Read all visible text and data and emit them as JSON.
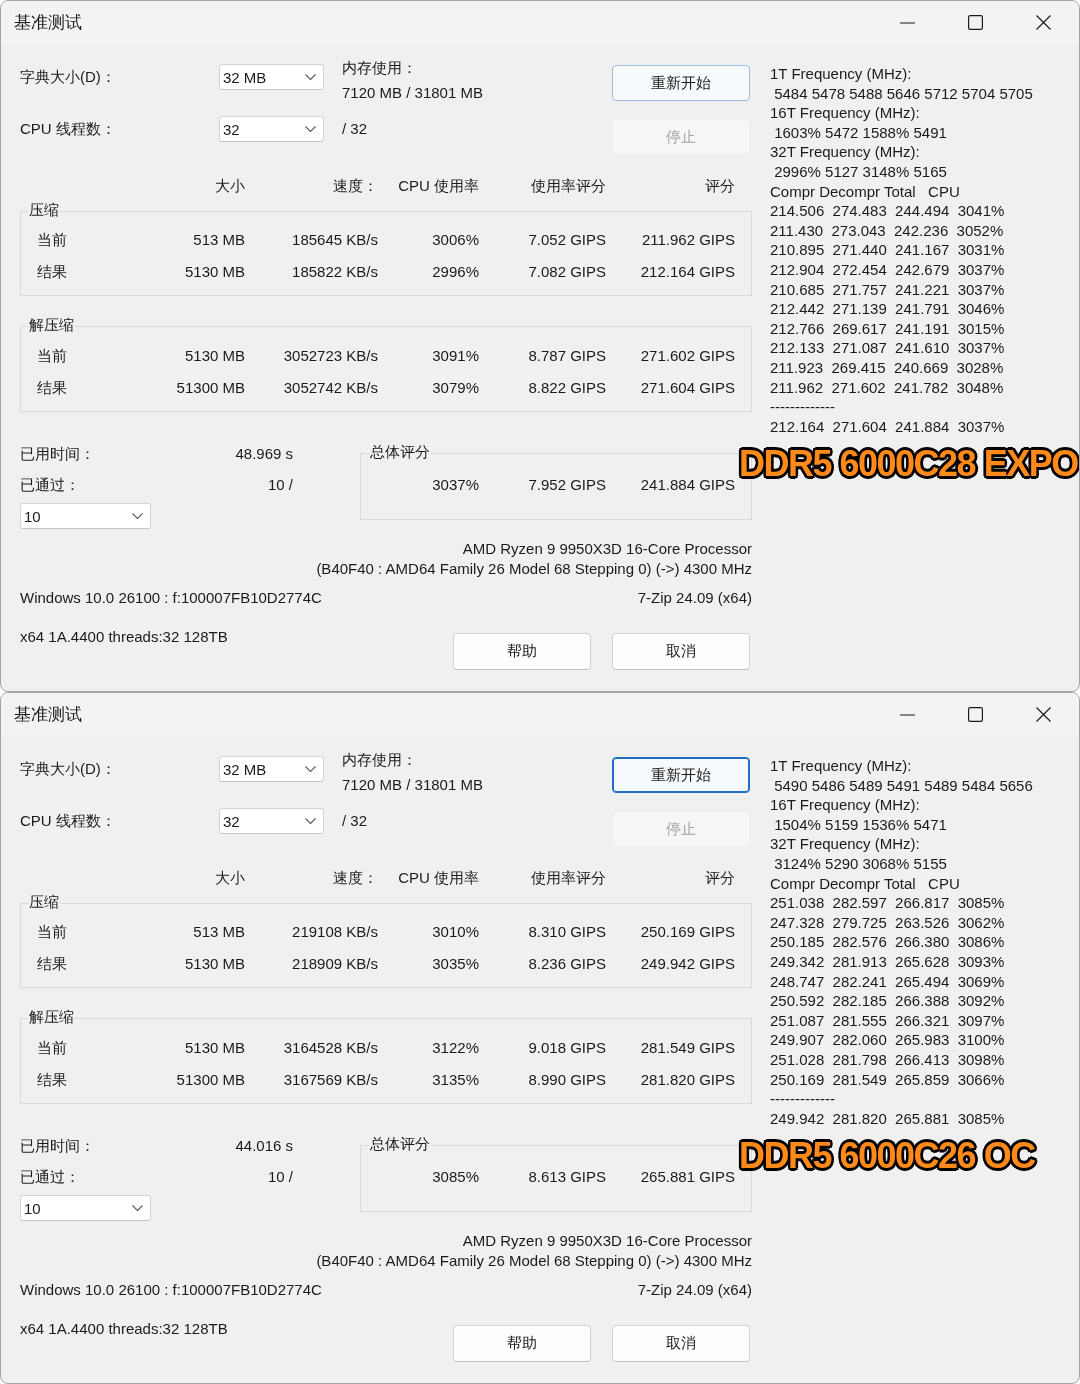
{
  "windows": [
    {
      "title": "基准测试",
      "dictionary_size": {
        "label": "字典大小(D)：",
        "value": "32 MB"
      },
      "memory_usage": {
        "label": "内存使用：",
        "value": "7120 MB / 31801 MB"
      },
      "threads": {
        "label": "CPU 线程数：",
        "value": "32",
        "max": "/ 32"
      },
      "top_buttons": [
        {
          "label": "重新开始",
          "default": true,
          "focused": false,
          "disabled": false
        },
        {
          "label": "停止",
          "default": false,
          "focused": false,
          "disabled": true
        }
      ],
      "columns": [
        "大小",
        "速度：",
        "CPU 使用率",
        "使用率评分",
        "评分"
      ],
      "groups": [
        {
          "title": "压缩",
          "rows": [
            {
              "label": "当前",
              "cells": [
                "513 MB",
                "185645 KB/s",
                "3006%",
                "7.052 GIPS",
                "211.962 GIPS"
              ]
            },
            {
              "label": "结果",
              "cells": [
                "5130 MB",
                "185822 KB/s",
                "2996%",
                "7.082 GIPS",
                "212.164 GIPS"
              ]
            }
          ]
        },
        {
          "title": "解压缩",
          "rows": [
            {
              "label": "当前",
              "cells": [
                "5130 MB",
                "3052723 KB/s",
                "3091%",
                "8.787 GIPS",
                "271.602 GIPS"
              ]
            },
            {
              "label": "结果",
              "cells": [
                "51300 MB",
                "3052742 KB/s",
                "3079%",
                "8.822 GIPS",
                "271.604 GIPS"
              ]
            }
          ]
        }
      ],
      "elapsed": {
        "label": "已用时间：",
        "value": "48.969 s"
      },
      "passes": {
        "label": "已通过：",
        "value": "10 /",
        "dropdown": "10"
      },
      "total": {
        "title": "总体评分",
        "cells": [
          "3037%",
          "7.952 GIPS",
          "241.884 GIPS"
        ]
      },
      "cpu_info": [
        "AMD Ryzen 9 9950X3D 16-Core Processor",
        "(B40F40 : AMD64 Family 26 Model 68 Stepping 0) (->) 4300 MHz"
      ],
      "system_info": "Windows 10.0 26100 : f:100007FB10D2774C",
      "version": "7-Zip 24.09 (x64)",
      "build_info": "x64 1A.4400 threads:32 128TB",
      "bottom_buttons": [
        {
          "label": "帮助"
        },
        {
          "label": "取消"
        }
      ],
      "log_lines": [
        "1T Frequency (MHz):",
        " 5484 5478 5488 5646 5712 5704 5705",
        "16T Frequency (MHz):",
        " 1603% 5472 1588% 5491",
        "32T Frequency (MHz):",
        " 2996% 5127 3148% 5165",
        "Compr Decompr Total   CPU",
        "214.506  274.483  244.494  3041%",
        "211.430  273.043  242.236  3052%",
        "210.895  271.440  241.167  3031%",
        "212.904  272.454  242.679  3037%",
        "210.685  271.757  241.221  3037%",
        "212.442  271.139  241.791  3046%",
        "212.766  269.617  241.191  3015%",
        "212.133  271.087  241.610  3037%",
        "211.923  269.415  240.669  3028%",
        "211.962  271.602  241.782  3048%",
        "-------------",
        "212.164  271.604  241.884  3037%"
      ],
      "overlay_label": "DDR5 6000C28 EXPO"
    },
    {
      "title": "基准测试",
      "dictionary_size": {
        "label": "字典大小(D)：",
        "value": "32 MB"
      },
      "memory_usage": {
        "label": "内存使用：",
        "value": "7120 MB / 31801 MB"
      },
      "threads": {
        "label": "CPU 线程数：",
        "value": "32",
        "max": "/ 32"
      },
      "top_buttons": [
        {
          "label": "重新开始",
          "default": true,
          "focused": true,
          "disabled": false
        },
        {
          "label": "停止",
          "default": false,
          "focused": false,
          "disabled": true
        }
      ],
      "columns": [
        "大小",
        "速度：",
        "CPU 使用率",
        "使用率评分",
        "评分"
      ],
      "groups": [
        {
          "title": "压缩",
          "rows": [
            {
              "label": "当前",
              "cells": [
                "513 MB",
                "219108 KB/s",
                "3010%",
                "8.310 GIPS",
                "250.169 GIPS"
              ]
            },
            {
              "label": "结果",
              "cells": [
                "5130 MB",
                "218909 KB/s",
                "3035%",
                "8.236 GIPS",
                "249.942 GIPS"
              ]
            }
          ]
        },
        {
          "title": "解压缩",
          "rows": [
            {
              "label": "当前",
              "cells": [
                "5130 MB",
                "3164528 KB/s",
                "3122%",
                "9.018 GIPS",
                "281.549 GIPS"
              ]
            },
            {
              "label": "结果",
              "cells": [
                "51300 MB",
                "3167569 KB/s",
                "3135%",
                "8.990 GIPS",
                "281.820 GIPS"
              ]
            }
          ]
        }
      ],
      "elapsed": {
        "label": "已用时间：",
        "value": "44.016 s"
      },
      "passes": {
        "label": "已通过：",
        "value": "10 /",
        "dropdown": "10"
      },
      "total": {
        "title": "总体评分",
        "cells": [
          "3085%",
          "8.613 GIPS",
          "265.881 GIPS"
        ]
      },
      "cpu_info": [
        "AMD Ryzen 9 9950X3D 16-Core Processor",
        "(B40F40 : AMD64 Family 26 Model 68 Stepping 0) (->) 4300 MHz"
      ],
      "system_info": "Windows 10.0 26100 : f:100007FB10D2774C",
      "version": "7-Zip 24.09 (x64)",
      "build_info": "x64 1A.4400 threads:32 128TB",
      "bottom_buttons": [
        {
          "label": "帮助"
        },
        {
          "label": "取消"
        }
      ],
      "log_lines": [
        "1T Frequency (MHz):",
        " 5490 5486 5489 5491 5489 5484 5656",
        "16T Frequency (MHz):",
        " 1504% 5159 1536% 5471",
        "32T Frequency (MHz):",
        " 3124% 5290 3068% 5155",
        "Compr Decompr Total   CPU",
        "251.038  282.597  266.817  3085%",
        "247.328  279.725  263.526  3062%",
        "250.185  282.576  266.380  3086%",
        "249.342  281.913  265.628  3093%",
        "248.747  282.241  265.494  3069%",
        "250.592  282.185  266.388  3092%",
        "251.087  281.555  266.321  3097%",
        "249.907  282.060  265.983  3100%",
        "251.028  281.798  266.413  3098%",
        "250.169  281.549  265.859  3066%",
        "-------------",
        "249.942  281.820  265.881  3085%"
      ],
      "overlay_label": "DDR5 6000C26 OC"
    }
  ]
}
